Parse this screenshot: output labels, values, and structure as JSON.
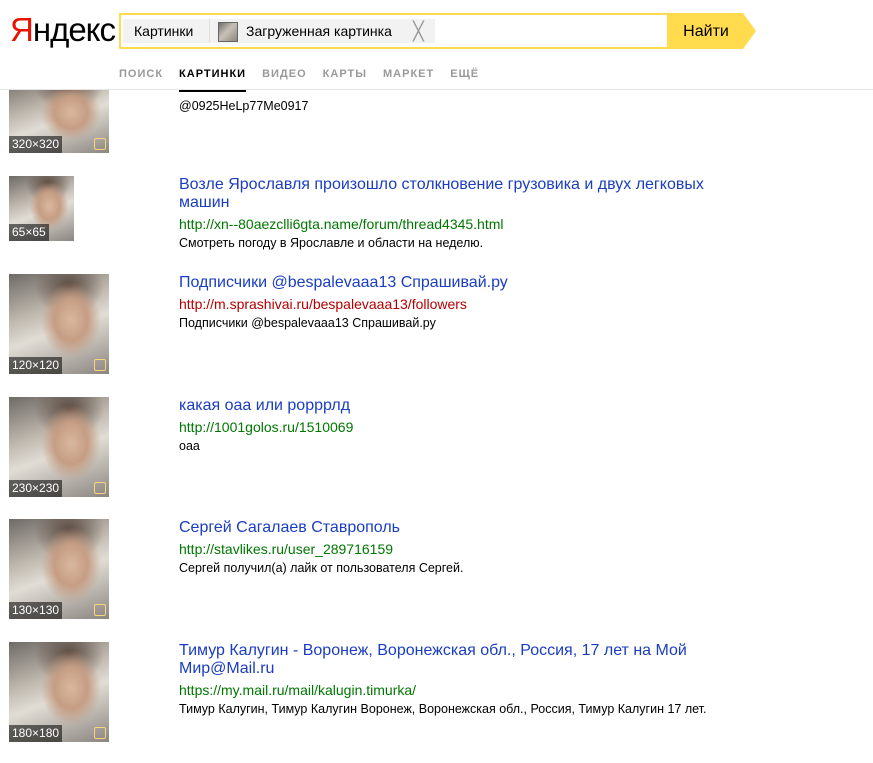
{
  "logo": {
    "first": "Я",
    "rest": "ндекс"
  },
  "search": {
    "category_chip": "Картинки",
    "image_chip": "Загруженная картинка",
    "close_glyph": "╳",
    "button": "Найти"
  },
  "nav": {
    "tabs": [
      {
        "label": "ПОИСК"
      },
      {
        "label": "КАРТИНКИ",
        "active": true
      },
      {
        "label": "ВИДЕО"
      },
      {
        "label": "КАРТЫ"
      },
      {
        "label": "МАРКЕТ"
      },
      {
        "label": "ЕЩЁ"
      }
    ]
  },
  "results": [
    {
      "size": "320×320",
      "title": "",
      "url": "",
      "desc": "@0925HeLp77Me0917"
    },
    {
      "size": "65×65",
      "title": "Возле Ярославля произошло столкновение грузовика и двух легковых машин",
      "url": "http://xn--80aezclli6gta.name/forum/thread4345.html",
      "desc": "Смотреть погоду в Ярославле и области на неделю."
    },
    {
      "size": "120×120",
      "title": "Подписчики @bespalevaaa13 Спрашивай.ру",
      "url": "http://m.sprashivai.ru/bespalevaaa13/followers",
      "url_color": "red",
      "desc": "Подписчики @bespalevaaa13 Спрашивай.ру"
    },
    {
      "size": "230×230",
      "title": "какая оаа или рорррлд",
      "url": "http://1001golos.ru/1510069",
      "desc": "оаа"
    },
    {
      "size": "130×130",
      "title": "Сергей Сагалаев Ставрополь",
      "url": "http://stavlikes.ru/user_289716159",
      "desc": "Сергей получил(а) лайк от пользователя Сергей."
    },
    {
      "size": "180×180",
      "title": "Тимур Калугин - Воронеж, Воронежская обл., Россия, 17 лет на Мой Мир@Mail.ru",
      "url": "https://my.mail.ru/mail/kalugin.timurka/",
      "desc": "Тимур Калугин, Тимур Калугин Воронеж, Воронежская обл., Россия, Тимур Калугин 17 лет."
    }
  ]
}
